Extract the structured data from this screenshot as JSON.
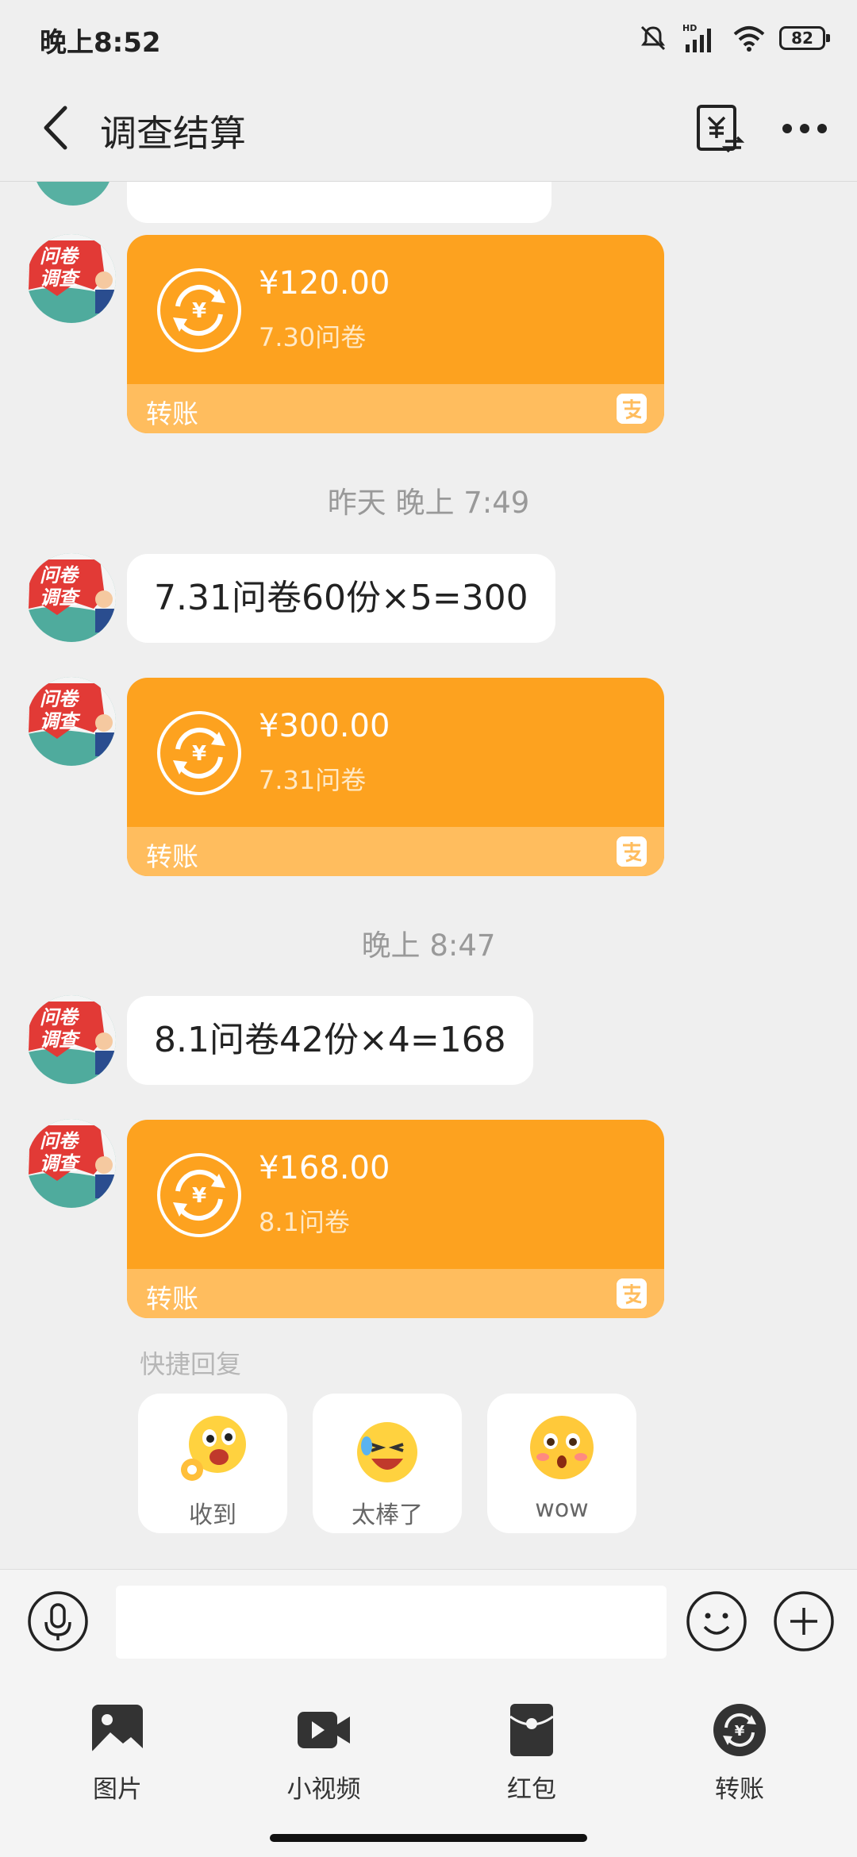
{
  "status_bar": {
    "time": "晚上8:52",
    "battery": "82",
    "network": "HD"
  },
  "nav": {
    "title": "调查结算"
  },
  "avatar": {
    "line1": "问卷",
    "line2": "调查"
  },
  "messages": [
    {
      "kind": "transfer",
      "amount": "¥120.00",
      "memo": "7.30问卷",
      "label": "转账"
    },
    {
      "kind": "timestamp",
      "text": "昨天 晚上 7:49"
    },
    {
      "kind": "text",
      "text": "7.31问卷60份×5=300"
    },
    {
      "kind": "transfer",
      "amount": "¥300.00",
      "memo": "7.31问卷",
      "label": "转账"
    },
    {
      "kind": "timestamp",
      "text": "晚上 8:47"
    },
    {
      "kind": "text",
      "text": "8.1问卷42份×4=168"
    },
    {
      "kind": "transfer",
      "amount": "¥168.00",
      "memo": "8.1问卷",
      "label": "转账"
    }
  ],
  "quick_reply": {
    "label": "快捷回复",
    "items": [
      {
        "text": "收到",
        "icon": "ok-emoji-icon"
      },
      {
        "text": "太棒了",
        "icon": "laughing-emoji-icon"
      },
      {
        "text": "wow",
        "icon": "surprised-emoji-icon"
      }
    ]
  },
  "input": {
    "placeholder": ""
  },
  "tools": [
    {
      "label": "图片",
      "icon": "image-icon"
    },
    {
      "label": "小视频",
      "icon": "video-icon"
    },
    {
      "label": "红包",
      "icon": "red-packet-icon"
    },
    {
      "label": "转账",
      "icon": "transfer-icon"
    }
  ],
  "colors": {
    "transfer_card": "#fda21f",
    "transfer_footer": "#ffbd5e",
    "background": "#efefef"
  }
}
